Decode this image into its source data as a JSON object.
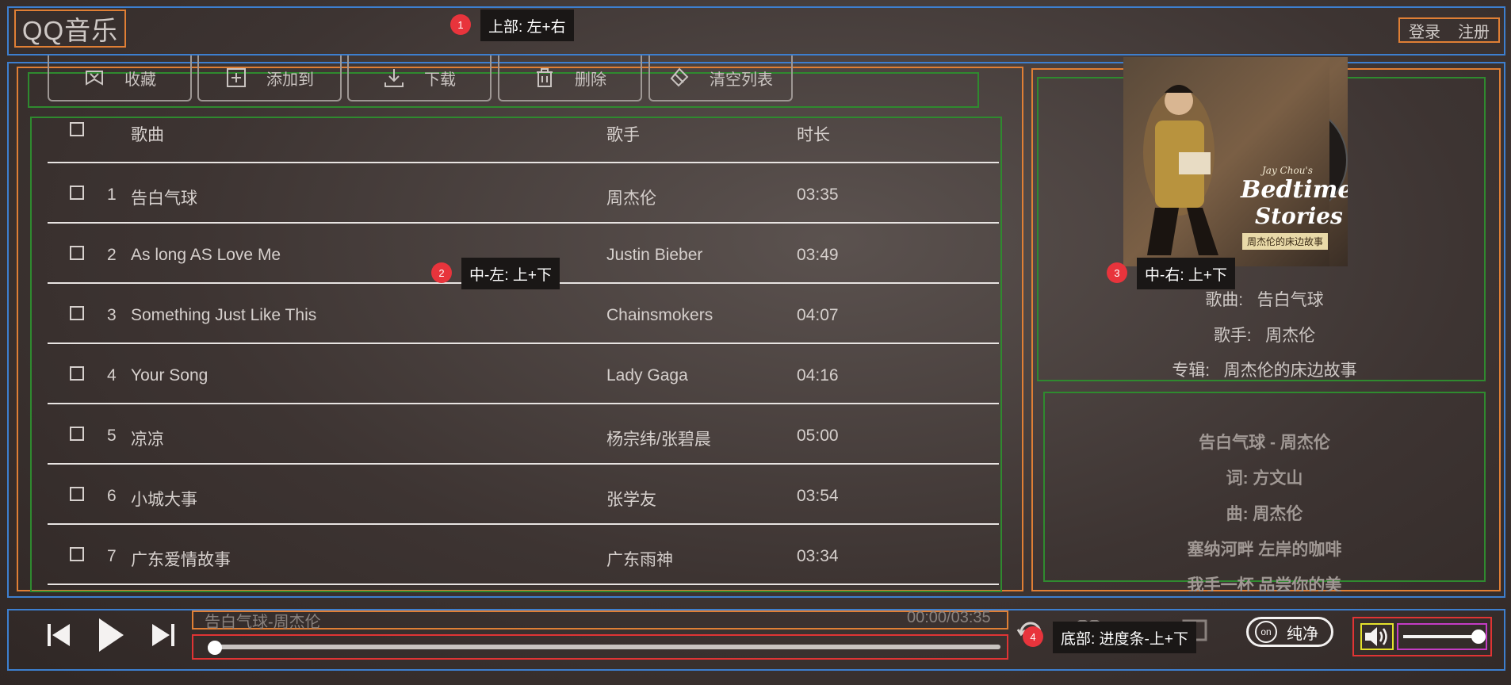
{
  "header": {
    "logo": "QQ音乐",
    "login": "登录",
    "register": "注册",
    "annotation_number": "1",
    "annotation_text": "上部: 左+右"
  },
  "toolbar": {
    "buttons": [
      {
        "label": "收藏",
        "icon": "favorite-icon"
      },
      {
        "label": "添加到",
        "icon": "add-to-icon"
      },
      {
        "label": "下载",
        "icon": "download-icon"
      },
      {
        "label": "删除",
        "icon": "delete-icon"
      },
      {
        "label": "清空列表",
        "icon": "clear-list-icon"
      }
    ]
  },
  "song_table": {
    "columns": [
      "歌曲",
      "歌手",
      "时长"
    ],
    "rows": [
      {
        "num": "1",
        "title": "告白气球",
        "artist": "周杰伦",
        "duration": "03:35"
      },
      {
        "num": "2",
        "title": "As long AS Love Me",
        "artist": "Justin Bieber",
        "duration": "03:49"
      },
      {
        "num": "3",
        "title": "Something Just Like This",
        "artist": "Chainsmokers",
        "duration": "04:07"
      },
      {
        "num": "4",
        "title": "Your Song",
        "artist": "Lady Gaga",
        "duration": "04:16"
      },
      {
        "num": "5",
        "title": "凉凉",
        "artist": "杨宗纬/张碧晨",
        "duration": "05:00"
      },
      {
        "num": "6",
        "title": "小城大事",
        "artist": "张学友",
        "duration": "03:54"
      },
      {
        "num": "7",
        "title": "广东爱情故事",
        "artist": "广东雨神",
        "duration": "03:34"
      }
    ]
  },
  "annotations": {
    "middle_left_number": "2",
    "middle_left_text": "中-左: 上+下",
    "middle_right_number": "3",
    "middle_right_text": "中-右: 上+下",
    "bottom_number": "4",
    "bottom_text": "底部: 进度条-上+下"
  },
  "album": {
    "cover_artist": "Jay Chou's",
    "cover_title_1": "Bedtime",
    "cover_title_2": "Stories",
    "cover_cn": "周杰伦的床边故事"
  },
  "song_info": {
    "song_label": "歌曲:",
    "song_value": "告白气球",
    "artist_label": "歌手:",
    "artist_value": "周杰伦",
    "album_label": "专辑:",
    "album_value": "周杰伦的床边故事"
  },
  "lyrics": [
    "告白气球 - 周杰伦",
    "词: 方文山",
    "曲: 周杰伦",
    "塞纳河畔 左岸的咖啡",
    "我手一杯 品尝你的美"
  ],
  "player": {
    "now_playing": "告白气球-周杰伦",
    "time": "00:00/03:35",
    "progress": 0,
    "volume": 1,
    "pure_mode_toggle": "on",
    "pure_mode_label": "纯净"
  },
  "colors": {
    "annotation_blue": "#3d7fcf",
    "annotation_orange": "#e07f35",
    "annotation_green": "#2f8a2f",
    "annotation_red": "#e03434",
    "annotation_purple": "#c43cc4",
    "annotation_yellow": "#e4e12c",
    "badge_red": "#e8343c"
  }
}
